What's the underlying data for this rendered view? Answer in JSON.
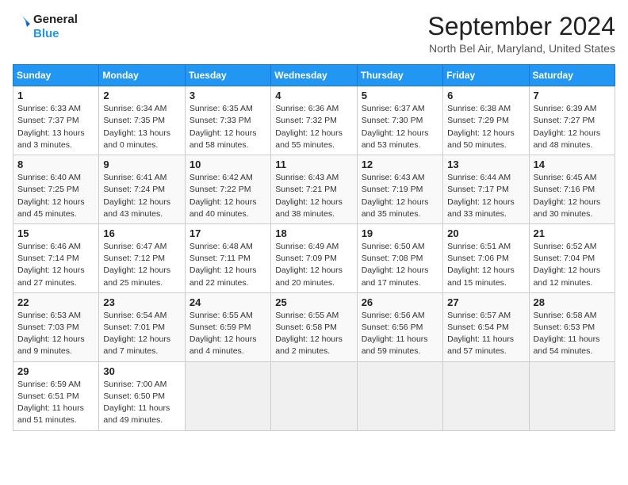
{
  "header": {
    "logo_line1": "General",
    "logo_line2": "Blue",
    "month": "September 2024",
    "location": "North Bel Air, Maryland, United States"
  },
  "days_of_week": [
    "Sunday",
    "Monday",
    "Tuesday",
    "Wednesday",
    "Thursday",
    "Friday",
    "Saturday"
  ],
  "weeks": [
    [
      {
        "day": "1",
        "info": "Sunrise: 6:33 AM\nSunset: 7:37 PM\nDaylight: 13 hours\nand 3 minutes."
      },
      {
        "day": "2",
        "info": "Sunrise: 6:34 AM\nSunset: 7:35 PM\nDaylight: 13 hours\nand 0 minutes."
      },
      {
        "day": "3",
        "info": "Sunrise: 6:35 AM\nSunset: 7:33 PM\nDaylight: 12 hours\nand 58 minutes."
      },
      {
        "day": "4",
        "info": "Sunrise: 6:36 AM\nSunset: 7:32 PM\nDaylight: 12 hours\nand 55 minutes."
      },
      {
        "day": "5",
        "info": "Sunrise: 6:37 AM\nSunset: 7:30 PM\nDaylight: 12 hours\nand 53 minutes."
      },
      {
        "day": "6",
        "info": "Sunrise: 6:38 AM\nSunset: 7:29 PM\nDaylight: 12 hours\nand 50 minutes."
      },
      {
        "day": "7",
        "info": "Sunrise: 6:39 AM\nSunset: 7:27 PM\nDaylight: 12 hours\nand 48 minutes."
      }
    ],
    [
      {
        "day": "8",
        "info": "Sunrise: 6:40 AM\nSunset: 7:25 PM\nDaylight: 12 hours\nand 45 minutes."
      },
      {
        "day": "9",
        "info": "Sunrise: 6:41 AM\nSunset: 7:24 PM\nDaylight: 12 hours\nand 43 minutes."
      },
      {
        "day": "10",
        "info": "Sunrise: 6:42 AM\nSunset: 7:22 PM\nDaylight: 12 hours\nand 40 minutes."
      },
      {
        "day": "11",
        "info": "Sunrise: 6:43 AM\nSunset: 7:21 PM\nDaylight: 12 hours\nand 38 minutes."
      },
      {
        "day": "12",
        "info": "Sunrise: 6:43 AM\nSunset: 7:19 PM\nDaylight: 12 hours\nand 35 minutes."
      },
      {
        "day": "13",
        "info": "Sunrise: 6:44 AM\nSunset: 7:17 PM\nDaylight: 12 hours\nand 33 minutes."
      },
      {
        "day": "14",
        "info": "Sunrise: 6:45 AM\nSunset: 7:16 PM\nDaylight: 12 hours\nand 30 minutes."
      }
    ],
    [
      {
        "day": "15",
        "info": "Sunrise: 6:46 AM\nSunset: 7:14 PM\nDaylight: 12 hours\nand 27 minutes."
      },
      {
        "day": "16",
        "info": "Sunrise: 6:47 AM\nSunset: 7:12 PM\nDaylight: 12 hours\nand 25 minutes."
      },
      {
        "day": "17",
        "info": "Sunrise: 6:48 AM\nSunset: 7:11 PM\nDaylight: 12 hours\nand 22 minutes."
      },
      {
        "day": "18",
        "info": "Sunrise: 6:49 AM\nSunset: 7:09 PM\nDaylight: 12 hours\nand 20 minutes."
      },
      {
        "day": "19",
        "info": "Sunrise: 6:50 AM\nSunset: 7:08 PM\nDaylight: 12 hours\nand 17 minutes."
      },
      {
        "day": "20",
        "info": "Sunrise: 6:51 AM\nSunset: 7:06 PM\nDaylight: 12 hours\nand 15 minutes."
      },
      {
        "day": "21",
        "info": "Sunrise: 6:52 AM\nSunset: 7:04 PM\nDaylight: 12 hours\nand 12 minutes."
      }
    ],
    [
      {
        "day": "22",
        "info": "Sunrise: 6:53 AM\nSunset: 7:03 PM\nDaylight: 12 hours\nand 9 minutes."
      },
      {
        "day": "23",
        "info": "Sunrise: 6:54 AM\nSunset: 7:01 PM\nDaylight: 12 hours\nand 7 minutes."
      },
      {
        "day": "24",
        "info": "Sunrise: 6:55 AM\nSunset: 6:59 PM\nDaylight: 12 hours\nand 4 minutes."
      },
      {
        "day": "25",
        "info": "Sunrise: 6:55 AM\nSunset: 6:58 PM\nDaylight: 12 hours\nand 2 minutes."
      },
      {
        "day": "26",
        "info": "Sunrise: 6:56 AM\nSunset: 6:56 PM\nDaylight: 11 hours\nand 59 minutes."
      },
      {
        "day": "27",
        "info": "Sunrise: 6:57 AM\nSunset: 6:54 PM\nDaylight: 11 hours\nand 57 minutes."
      },
      {
        "day": "28",
        "info": "Sunrise: 6:58 AM\nSunset: 6:53 PM\nDaylight: 11 hours\nand 54 minutes."
      }
    ],
    [
      {
        "day": "29",
        "info": "Sunrise: 6:59 AM\nSunset: 6:51 PM\nDaylight: 11 hours\nand 51 minutes."
      },
      {
        "day": "30",
        "info": "Sunrise: 7:00 AM\nSunset: 6:50 PM\nDaylight: 11 hours\nand 49 minutes."
      },
      {
        "day": "",
        "info": ""
      },
      {
        "day": "",
        "info": ""
      },
      {
        "day": "",
        "info": ""
      },
      {
        "day": "",
        "info": ""
      },
      {
        "day": "",
        "info": ""
      }
    ]
  ]
}
